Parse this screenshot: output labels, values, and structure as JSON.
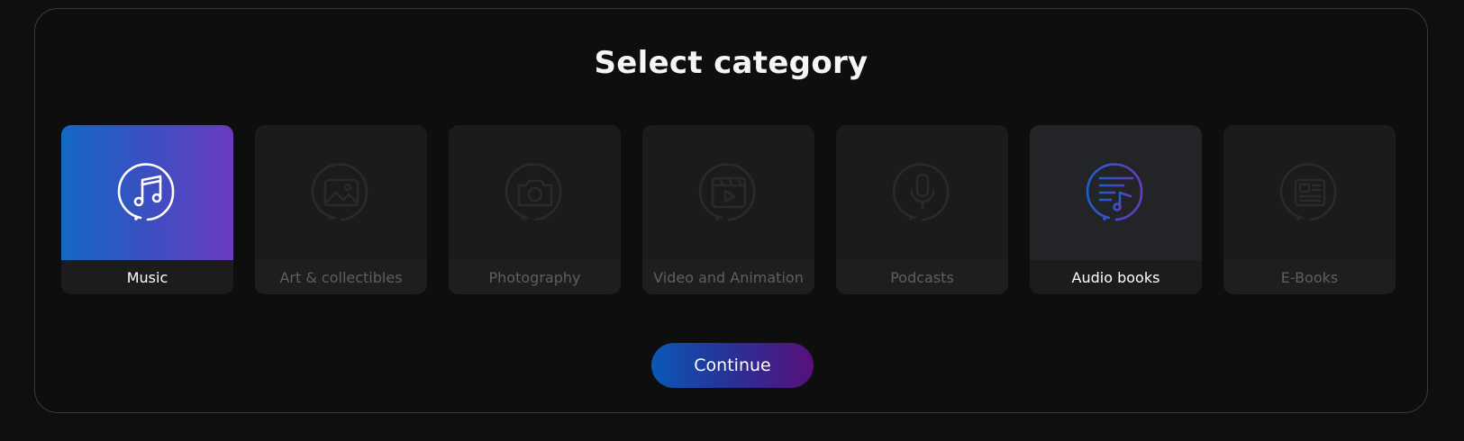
{
  "page": {
    "title": "Select category",
    "continue_label": "Continue"
  },
  "categories": [
    {
      "label": "Music",
      "icon": "music-note-icon",
      "state": "selected"
    },
    {
      "label": "Art & collectibles",
      "icon": "image-icon",
      "state": "default"
    },
    {
      "label": "Photography",
      "icon": "camera-icon",
      "state": "default"
    },
    {
      "label": "Video and Animation",
      "icon": "video-clapper-icon",
      "state": "default"
    },
    {
      "label": "Podcasts",
      "icon": "microphone-icon",
      "state": "default"
    },
    {
      "label": "Audio books",
      "icon": "audio-book-icon",
      "state": "hover"
    },
    {
      "label": "E-Books",
      "icon": "newspaper-icon",
      "state": "default"
    }
  ],
  "colors": {
    "background": "#0f0f0f",
    "card": "#1b1b1b",
    "accent_start": "#1368c4",
    "accent_end": "#6a3bbf",
    "muted_text": "#5f5f5f"
  }
}
